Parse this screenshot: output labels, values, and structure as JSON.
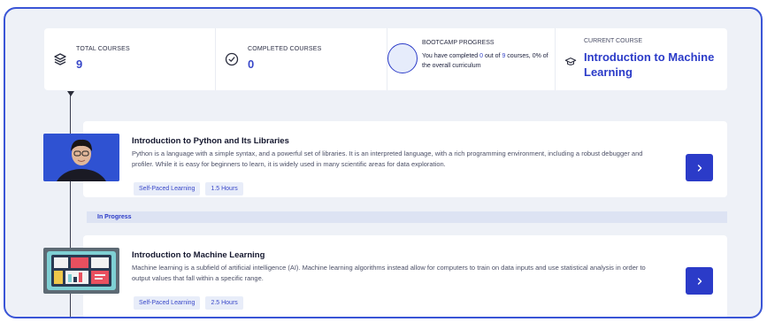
{
  "stats": {
    "total_courses": {
      "label": "TOTAL COURSES",
      "value": "9",
      "icon": "layers-icon"
    },
    "completed_courses": {
      "label": "COMPLETED COURSES",
      "value": "0",
      "icon": "check-circle-icon"
    },
    "bootcamp_progress": {
      "label": "BOOTCAMP PROGRESS",
      "text_before": "You have completed ",
      "completed": "0",
      "text_mid": " out of ",
      "total": "9",
      "text_after": " courses, 0% of the overall curriculum",
      "percent": 0
    },
    "current_course": {
      "label": "CURRENT COURSE",
      "title": "Introduction to Machine Learning",
      "icon": "graduation-cap-icon"
    }
  },
  "courses": [
    {
      "title": "Introduction to Python and Its Libraries",
      "description": "Python is a language with a simple syntax, and a powerful set of libraries. It is an interpreted language, with a rich programming environment, including a robust debugger and profiler. While it is easy for beginners to learn, it is widely used in many scientific areas for data exploration.",
      "tags": [
        "Self-Paced Learning",
        "1.5 Hours"
      ],
      "button_icon": "chevron-right-icon",
      "status": "In Progress"
    },
    {
      "title": "Introduction to Machine Learning",
      "description": "Machine learning is a subfield of artificial intelligence (AI). Machine learning algorithms instead allow for computers to train on data inputs and use statistical analysis in order to output values that fall within a specific range.",
      "tags": [
        "Self-Paced Learning",
        "2.5 Hours"
      ],
      "button_icon": "chevron-right-icon"
    }
  ],
  "colors": {
    "accent": "#2b3bc8",
    "frame_border": "#3a55d6",
    "background": "#eef1f7",
    "tag_background": "#e8edf9"
  }
}
